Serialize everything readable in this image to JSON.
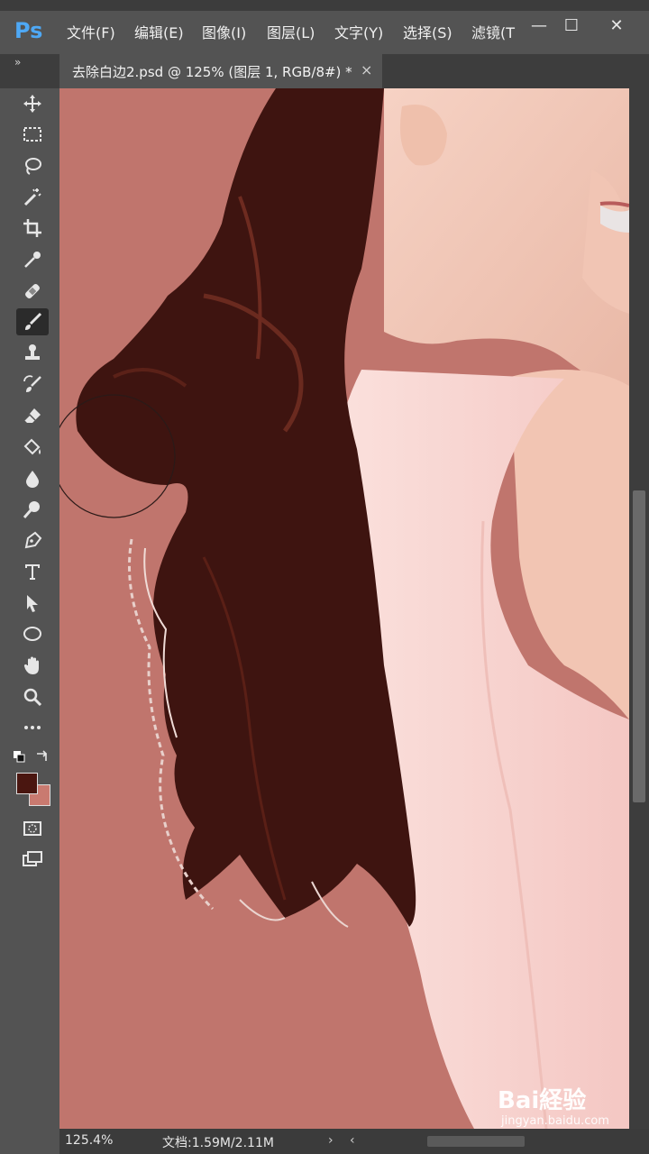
{
  "app": {
    "logo": "Ps"
  },
  "menu": [
    "文件(F)",
    "编辑(E)",
    "图像(I)",
    "图层(L)",
    "文字(Y)",
    "选择(S)",
    "滤镜(T"
  ],
  "window_controls": {
    "minimize": "—",
    "maximize": "☐",
    "close": "✕"
  },
  "tab": {
    "title": "去除白边2.psd @ 125% (图层 1, RGB/8#) *",
    "close": "×"
  },
  "panel_collapse": "»",
  "tools": [
    {
      "name": "move-tool",
      "icon": "move-icon"
    },
    {
      "name": "marquee-tool",
      "icon": "rect-marquee-icon"
    },
    {
      "name": "lasso-tool",
      "icon": "lasso-icon"
    },
    {
      "name": "magic-wand-tool",
      "icon": "magic-wand-icon"
    },
    {
      "name": "crop-tool",
      "icon": "crop-icon"
    },
    {
      "name": "eyedropper-tool",
      "icon": "eyedropper-icon"
    },
    {
      "name": "healing-brush-tool",
      "icon": "bandage-icon"
    },
    {
      "name": "brush-tool",
      "icon": "brush-icon",
      "active": true
    },
    {
      "name": "clone-stamp-tool",
      "icon": "stamp-icon"
    },
    {
      "name": "history-brush-tool",
      "icon": "history-brush-icon"
    },
    {
      "name": "eraser-tool",
      "icon": "eraser-icon"
    },
    {
      "name": "paint-bucket-tool",
      "icon": "paint-bucket-icon"
    },
    {
      "name": "blur-tool",
      "icon": "drop-icon"
    },
    {
      "name": "dodge-tool",
      "icon": "dodge-icon"
    },
    {
      "name": "pen-tool",
      "icon": "pen-icon"
    },
    {
      "name": "type-tool",
      "icon": "type-icon"
    },
    {
      "name": "path-selection-tool",
      "icon": "arrow-icon"
    },
    {
      "name": "ellipse-tool",
      "icon": "ellipse-icon"
    },
    {
      "name": "hand-tool",
      "icon": "hand-icon"
    },
    {
      "name": "zoom-tool",
      "icon": "zoom-icon"
    },
    {
      "name": "more-tools",
      "icon": "ellipsis-icon"
    }
  ],
  "colors": {
    "foreground": "#4a1610",
    "background": "#c97a70",
    "canvas": "#c0756d",
    "dress": "#f7cfcc",
    "hair": "#3e1410",
    "skin": "#f3c9b8"
  },
  "status": {
    "zoom": "125.4%",
    "doc": "文档:1.59M/2.11M",
    "nav_right": "›",
    "nav_left": "‹"
  },
  "watermark": {
    "text": "Bai経验",
    "sub": "jingyan.baidu.com"
  }
}
